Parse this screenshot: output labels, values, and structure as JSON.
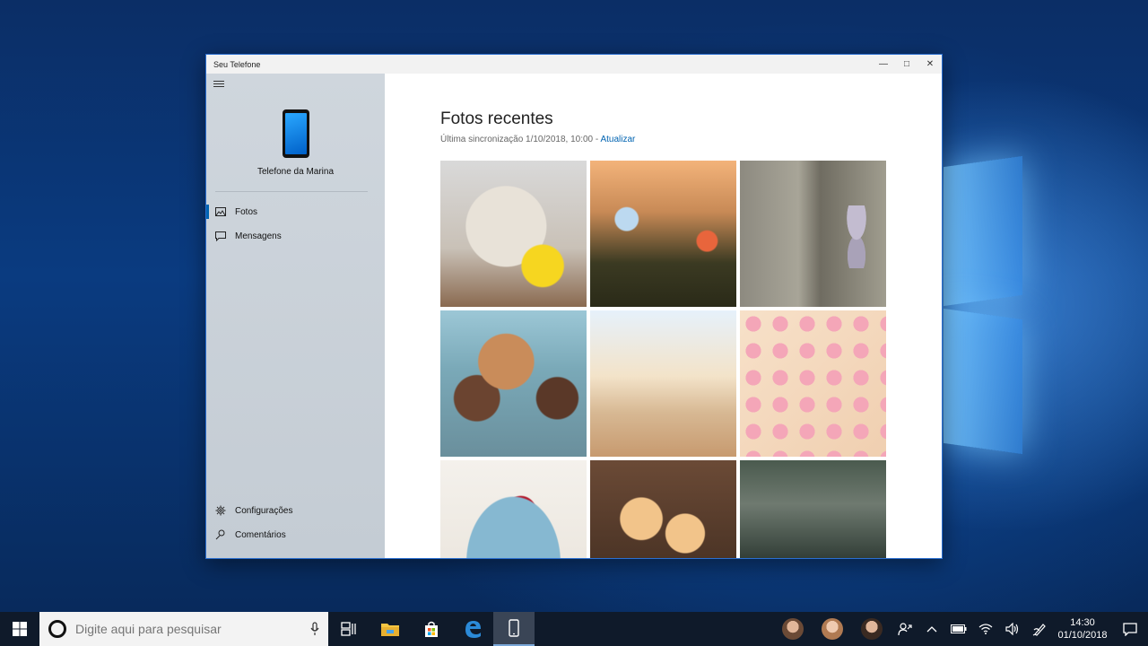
{
  "window": {
    "title": "Seu Telefone",
    "minimize_glyph": "—",
    "maximize_glyph": "□",
    "close_glyph": "✕"
  },
  "sidebar": {
    "device_name": "Telefone da Marina",
    "nav": [
      {
        "label": "Fotos",
        "icon": "photo-icon",
        "active": true
      },
      {
        "label": "Mensagens",
        "icon": "message-icon",
        "active": false
      }
    ],
    "bottom": [
      {
        "label": "Configurações",
        "icon": "gear-icon"
      },
      {
        "label": "Comentários",
        "icon": "feedback-icon"
      }
    ]
  },
  "main": {
    "title": "Fotos recentes",
    "sync_text": "Última sincronização 1/10/2018, 10:00 - ",
    "refresh_label": "Atualizar",
    "photos": [
      "dog-ball",
      "flowers",
      "feet-stones",
      "family-selfie",
      "beach-kite",
      "donuts",
      "cheesecake",
      "cupcakes",
      "storefront"
    ]
  },
  "taskbar": {
    "search_placeholder": "Digite aqui para pesquisar",
    "time": "14:30",
    "date": "01/10/2018"
  }
}
